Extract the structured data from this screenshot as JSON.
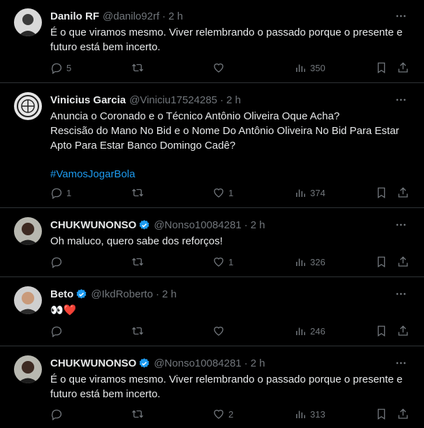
{
  "posts": [
    {
      "name": "Danilo RF",
      "handle": "@danilo92rf",
      "time": "2 h",
      "verified": false,
      "lines": [
        "É o que viramos mesmo. Viver relembrando o passado porque o presente e futuro está bem incerto."
      ],
      "hashtag": "",
      "replies": "5",
      "retweets": "",
      "likes": "",
      "views": "350"
    },
    {
      "name": "Vinicius Garcia",
      "handle": "@Viniciu17524285",
      "time": "2 h",
      "verified": false,
      "lines": [
        "Anuncia o Coronado e o Técnico Antônio Oliveira Oque Acha?",
        "Rescisão do Mano No Bid e o Nome Do Antônio Oliveira No Bid Para Estar Apto Para Estar Banco Domingo Cadê?"
      ],
      "hashtag": "#VamosJogarBola",
      "replies": "1",
      "retweets": "",
      "likes": "1",
      "views": "374"
    },
    {
      "name": "CHUKWUNONSO",
      "handle": "@Nonso10084281",
      "time": "2 h",
      "verified": true,
      "lines": [
        "Oh maluco, quero sabe dos reforços!"
      ],
      "hashtag": "",
      "replies": "",
      "retweets": "",
      "likes": "1",
      "views": "326"
    },
    {
      "name": "Beto",
      "handle": "@IkdRoberto",
      "time": "2 h",
      "verified": true,
      "lines": [
        "👀❤️"
      ],
      "hashtag": "",
      "replies": "",
      "retweets": "",
      "likes": "",
      "views": "246"
    },
    {
      "name": "CHUKWUNONSO",
      "handle": "@Nonso10084281",
      "time": "2 h",
      "verified": true,
      "lines": [
        "É o que viramos mesmo. Viver relembrando o passado porque o presente e futuro está bem incerto."
      ],
      "hashtag": "",
      "replies": "",
      "retweets": "",
      "likes": "2",
      "views": "313"
    }
  ],
  "separator": "·",
  "icons": {
    "reply": "reply-icon",
    "retweet": "retweet-icon",
    "like": "like-icon",
    "views": "views-icon",
    "bookmark": "bookmark-icon",
    "share": "share-icon",
    "more": "more-icon",
    "verified": "verified-badge-icon"
  },
  "colors": {
    "background": "#000000",
    "text": "#e7e9ea",
    "muted": "#71767b",
    "link": "#1d9bf0",
    "border": "#2f3336",
    "verified": "#1d9bf0"
  }
}
